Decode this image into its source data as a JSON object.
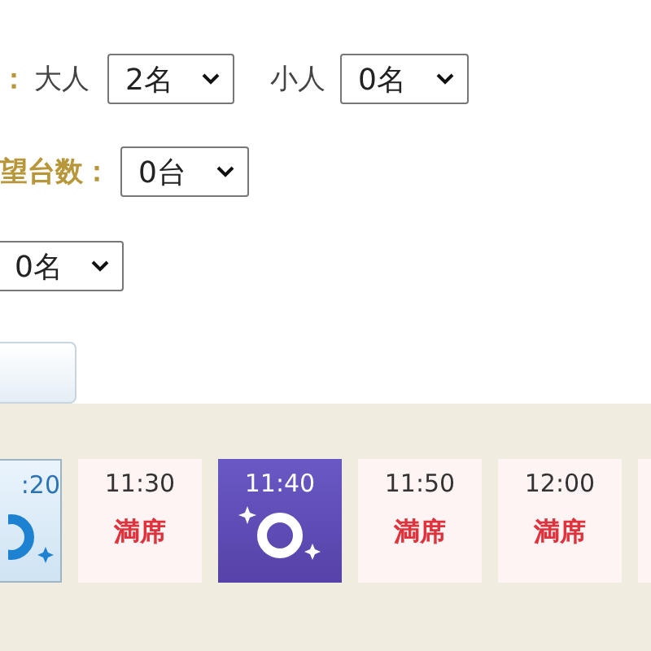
{
  "party": {
    "label_tail": "：",
    "adult_label": "大人",
    "adult_select": "2名",
    "child_label": "小人",
    "child_select": "0名"
  },
  "units": {
    "label": "望台数：",
    "select": "0台"
  },
  "extra": {
    "select": "0名"
  },
  "slots": [
    {
      "time": ":20",
      "kind": "available",
      "selected": false,
      "cut": true
    },
    {
      "time": "11:30",
      "kind": "full",
      "status": "満席",
      "selected": false
    },
    {
      "time": "11:40",
      "kind": "available",
      "selected": true
    },
    {
      "time": "11:50",
      "kind": "full",
      "status": "満席",
      "selected": false
    },
    {
      "time": "12:00",
      "kind": "full",
      "status": "満席",
      "selected": false
    }
  ]
}
